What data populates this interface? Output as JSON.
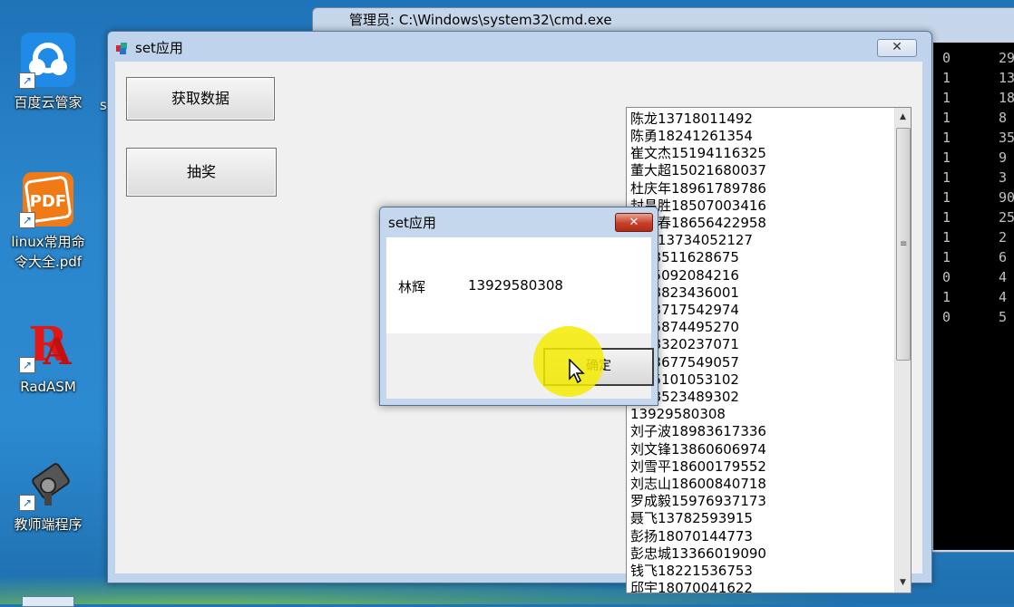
{
  "desktop": {
    "icons": [
      {
        "label": "百度云管家",
        "icon": "cloud-icon"
      },
      {
        "label": "linux常用命令大全.pdf",
        "icon": "pdf-icon"
      },
      {
        "label": "RadASM",
        "icon": "radasm-icon"
      },
      {
        "label": "教师端程序",
        "icon": "camera-icon"
      }
    ],
    "partial_label": "s"
  },
  "cmd_window": {
    "title": "管理员: C:\\Windows\\system32\\cmd.exe",
    "rows": [
      {
        "c1": "0",
        "c2": "29"
      },
      {
        "c1": "1",
        "c2": "13"
      },
      {
        "c1": "1",
        "c2": "18"
      },
      {
        "c1": "1",
        "c2": "8"
      },
      {
        "c1": "1",
        "c2": "35"
      },
      {
        "c1": "1",
        "c2": "9"
      },
      {
        "c1": "1",
        "c2": "3"
      },
      {
        "c1": "1",
        "c2": "90"
      },
      {
        "c1": "1",
        "c2": "25"
      },
      {
        "c1": "1",
        "c2": "2"
      },
      {
        "c1": "1",
        "c2": "6"
      },
      {
        "c1": "0",
        "c2": "4"
      },
      {
        "c1": "1",
        "c2": "4"
      },
      {
        "c1": "0",
        "c2": "5"
      }
    ]
  },
  "app": {
    "title": "set应用",
    "close_symbol": "✕",
    "get_data_button": "获取数据",
    "lottery_button": "抽奖",
    "list_items": [
      "陈龙13718011492",
      "陈勇18241261354",
      "崔文杰15194116325",
      "董大超15021680037",
      "杜庆年18961789786",
      "封昌胜18507003416",
      "冯金春18656422958",
      "韩飞13734052127",
      "强18511628675",
      "明15092084216",
      "文18823436001",
      "虎13717542974",
      "林15874495270",
      "云18320237071",
      "培13677549057",
      "鹏15101053102",
      "庭18523489302",
      "13929580308",
      "刘子波18983617336",
      "刘文锋13860606974",
      "刘雪平18600179552",
      "刘志山18600840718",
      "罗成毅15976937173",
      "聂飞13782593915",
      "彭扬18070144773",
      "彭忠城13366019090",
      "钱飞18221536753",
      "邱宇18070041622"
    ]
  },
  "dialog": {
    "title": "set应用",
    "close_symbol": "✕",
    "name": "林辉",
    "phone": "13929580308",
    "ok_button": "确定"
  }
}
